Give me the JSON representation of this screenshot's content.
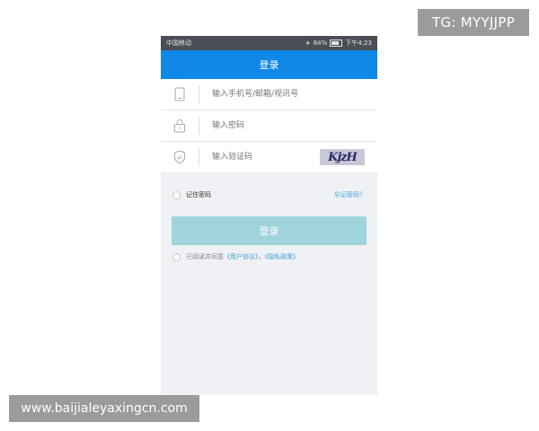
{
  "watermarks": {
    "top": "TG: MYYJJPP",
    "bottom": "www.baijialeyaxingcn.com"
  },
  "statusbar": {
    "carrier": "中国移动",
    "signal": "❙❙",
    "battery_pct": "84%",
    "time": "下午4:23"
  },
  "navbar": {
    "title": "登录"
  },
  "form": {
    "account_placeholder": "输入手机号/邮箱/视讯号",
    "password_placeholder": "输入密码",
    "captcha_placeholder": "输入验证码",
    "captcha_text": "KjzH"
  },
  "options": {
    "remember_label": "记住密码",
    "forgot_label": "忘记密码？"
  },
  "login_button": "登录",
  "agreement": {
    "prefix": "已阅读并同意",
    "user_agreement": "《用户协议》",
    "separator": "，",
    "privacy_policy": "《隐私政策》"
  },
  "colors": {
    "navbar": "#1088e8",
    "button": "#9fd4dc",
    "link": "#3f9fd6"
  }
}
